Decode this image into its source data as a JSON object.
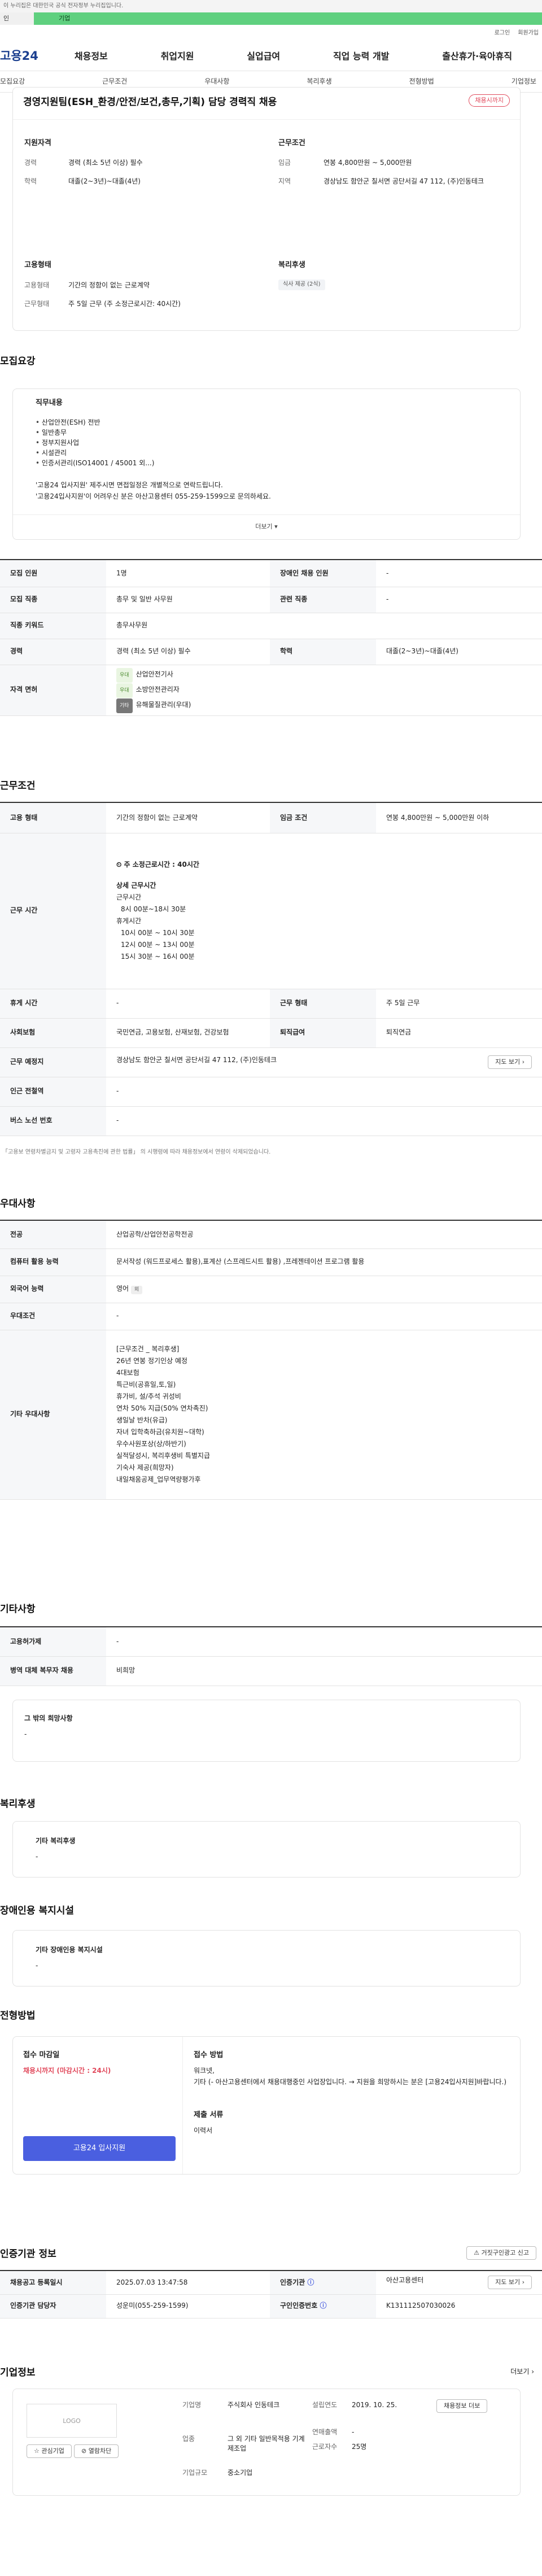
{
  "gov_notice": "이 누리집은 대한민국 공식 전자정부 누리집입니다.",
  "top_tabs": [
    "인",
    "기업"
  ],
  "util": {
    "login": "로그인",
    "join": "회원가입"
  },
  "logo": "고용24",
  "gnb": [
    "채용정보",
    "취업지원",
    "실업급여",
    "직업 능력 개발",
    "출산휴가·육아휴직"
  ],
  "lnb": [
    "모집요강",
    "근무조건",
    "우대사항",
    "복리후생",
    "전형방법",
    "기업정보"
  ],
  "job": {
    "title": "경영지원팀(ESH_환경/안전/보건,총무,기획) 담당 경력직 채용",
    "status": "채용시까지",
    "qual_title": "지원자격",
    "exp_label": "경력",
    "exp_val": "경력 (최소 5년 이상) 필수",
    "edu_label": "학력",
    "edu_val": "대졸(2~3년)~대졸(4년)",
    "cond_title": "근무조건",
    "pay_label": "임금",
    "pay_val": "연봉 4,800만원 ~ 5,000만원",
    "loc_label": "지역",
    "loc_val": "경상남도 함안군 칠서면 공단서길 47 112, (주)인동테크",
    "emp_title": "고용형태",
    "emptype_label": "고용형태",
    "emptype_val": "기간의 정함이 없는 근로계약",
    "worktime_label": "근무형태",
    "worktime_val": "주 5일 근무 (주 소정근로시간: 40시간)",
    "welfare_title": "복리후생",
    "welfare_chip": "식사 제공 (2식)"
  },
  "recruit": {
    "title": "모집요강",
    "duty_title": "직무내용",
    "duties": [
      "산업안전(ESH) 전반",
      "일반총무",
      "정부지원사업",
      "시설관리",
      "인증서관리(ISO14001 / 45001 외...)"
    ],
    "note1": "'고용24 입사지원' 제주시면 면접일정은 개별적으로 연락드립니다.",
    "note2": "'고용24입사지원'이 어려우신 분은 아산고용센터 055-259-1599으로 문의하세요.",
    "more": "더보기",
    "rows": [
      [
        "모집 인원",
        "1명",
        "장애인 채용 인원",
        "-"
      ],
      [
        "모집 직종",
        "총무 및 일반 사무원",
        "관련 직종",
        "-"
      ],
      [
        "직종 키워드",
        "총무사무원",
        "",
        ""
      ],
      [
        "경력",
        "경력 (최소 5년 이상) 필수",
        "학력",
        "대졸(2~3년)~대졸(4년)"
      ]
    ],
    "license_label": "자격 면허",
    "licenses": [
      {
        "tag": "우대",
        "name": "산업안전기사"
      },
      {
        "tag": "우대",
        "name": "소방안전관리자"
      },
      {
        "tag": "기타",
        "name": "유해물질관리(우대)"
      }
    ]
  },
  "work": {
    "title": "근무조건",
    "r1": [
      "고용 형태",
      "기간의 정함이 없는 근로계약",
      "임금 조건",
      "연봉 4,800만원 ~ 5,000만원 이하"
    ],
    "time_label": "근무 시간",
    "time_head": "주 소정근로시간 : 40시간",
    "time_detail_title": "상세 근무시간",
    "time_lines": [
      "근무시간",
      "8시 00분~18시 30분",
      "휴게시간"
    ],
    "break_lines": [
      "10시 00분 ~ 10시 30분",
      "12시 00분 ~ 13시 00분",
      "15시 30분 ~ 16시 00분"
    ],
    "r3": [
      "휴게 시간",
      "-",
      "근무 형태",
      "주 5일 근무"
    ],
    "r4": [
      "사회보험",
      "국민연금, 고용보험, 산재보험, 건강보험",
      "퇴직급여",
      "퇴직연금"
    ],
    "r5_label": "근무 예정지",
    "r5_val": "경상남도 함안군 칠서면 공단서길 47 112, (주)인동테크",
    "map_btn": "지도 보기",
    "r6": [
      "인근 전철역",
      "-"
    ],
    "r7": [
      "버스 노선 번호",
      "-"
    ],
    "footnote": "「고용보 연령차별금지 및 고령자 고용촉진에 관한 법률」 의 시행령에 따라 채용정보에서 연령이 삭제되었습니다."
  },
  "pref": {
    "title": "우대사항",
    "rows": [
      [
        "전공",
        "산업공학/산업안전공학전공"
      ],
      [
        "컴퓨터 활용 능력",
        "문서작성 (워드프로세스 활용),표계산 (스프레드시트 활용) ,프레젠테이션 프로그램 활용"
      ],
      [
        "외국어 능력",
        "영어"
      ],
      [
        "우대조건",
        "-"
      ]
    ],
    "lang_chip": "외",
    "other_label": "기타 우대사항",
    "other_head": "[근무조건 _ 복리후생]",
    "other_items": [
      "26년 연봉 정기인상 예정",
      "4대보험",
      "특근비(공휴일,토,일)",
      "휴가비, 설/추석 귀성비",
      "연차 50% 지급(50% 연차촉진)",
      "생일날 반차(유급)",
      "자녀 입학축하금(유치원~대학)",
      "우수사원포상(상/하반기)",
      "실적달성시, 복리후생비 특별지급",
      "기숙사 제공(희망자)",
      "내일채움공제_업무역량평가후"
    ]
  },
  "etc": {
    "title": "기타사항",
    "rows": [
      [
        "고용허가제",
        "-"
      ],
      [
        "병역 대체 복무자 채용",
        "비희망"
      ]
    ],
    "other_title": "그 밖의 희망사항",
    "other_val": "-"
  },
  "welfare": {
    "title": "복리후생",
    "box_title": "기타 복리후생",
    "box_val": "-"
  },
  "disab": {
    "title": "장애인용 복지시설",
    "box_title": "기타 장애인용 복지시설",
    "box_val": "-"
  },
  "process": {
    "title": "전형방법",
    "deadline_title": "접수 마감일",
    "deadline_val": "채용시까지 (마감시간 : 24시)",
    "apply_btn": "고용24 입사지원",
    "method_title": "접수 방법",
    "method_lines": [
      "워크넷,",
      "기타 (- 아산고용센터에서 채용대행중인 사업장입니다. → 지원을 희망하시는 분은 [고용24입사지원]바랍니다.)"
    ],
    "doc_title": "제출 서류",
    "doc_val": "이력서"
  },
  "info": {
    "title": "인증기관 정보",
    "report_btn": "거짓구인광고 신고",
    "rows": [
      [
        "채용공고 등록일시",
        "2025.07.03 13:47:58",
        "인증기관",
        "아산고용센터"
      ],
      [
        "인증기관 담당자",
        "성운미(055-259-1599)",
        "구인인증번호",
        "K131112507030026"
      ]
    ],
    "map_btn": "지도 보기"
  },
  "company": {
    "title": "기업정보",
    "more": "더보기",
    "logo": "LOGO",
    "fav_btn": "관심기업",
    "block_btn": "열람차단",
    "name_label": "기업명",
    "name_val": "주식회사 인동테크",
    "est_label": "설립연도",
    "est_val": "2019. 10. 25.",
    "ind_label": "업종",
    "ind_val": "그 외 기타 일반목적용 기계 제조업",
    "sales_label": "연매출액",
    "sales_val": "-",
    "emp_label": "근로자수",
    "emp_val": "25명",
    "size_label": "기업규모",
    "size_val": "중소기업",
    "list_btn": "채용정보 더보"
  },
  "colors": {
    "accent": "#e14a5c",
    "primary": "#4a5fe0",
    "green": "#5fd07f"
  }
}
